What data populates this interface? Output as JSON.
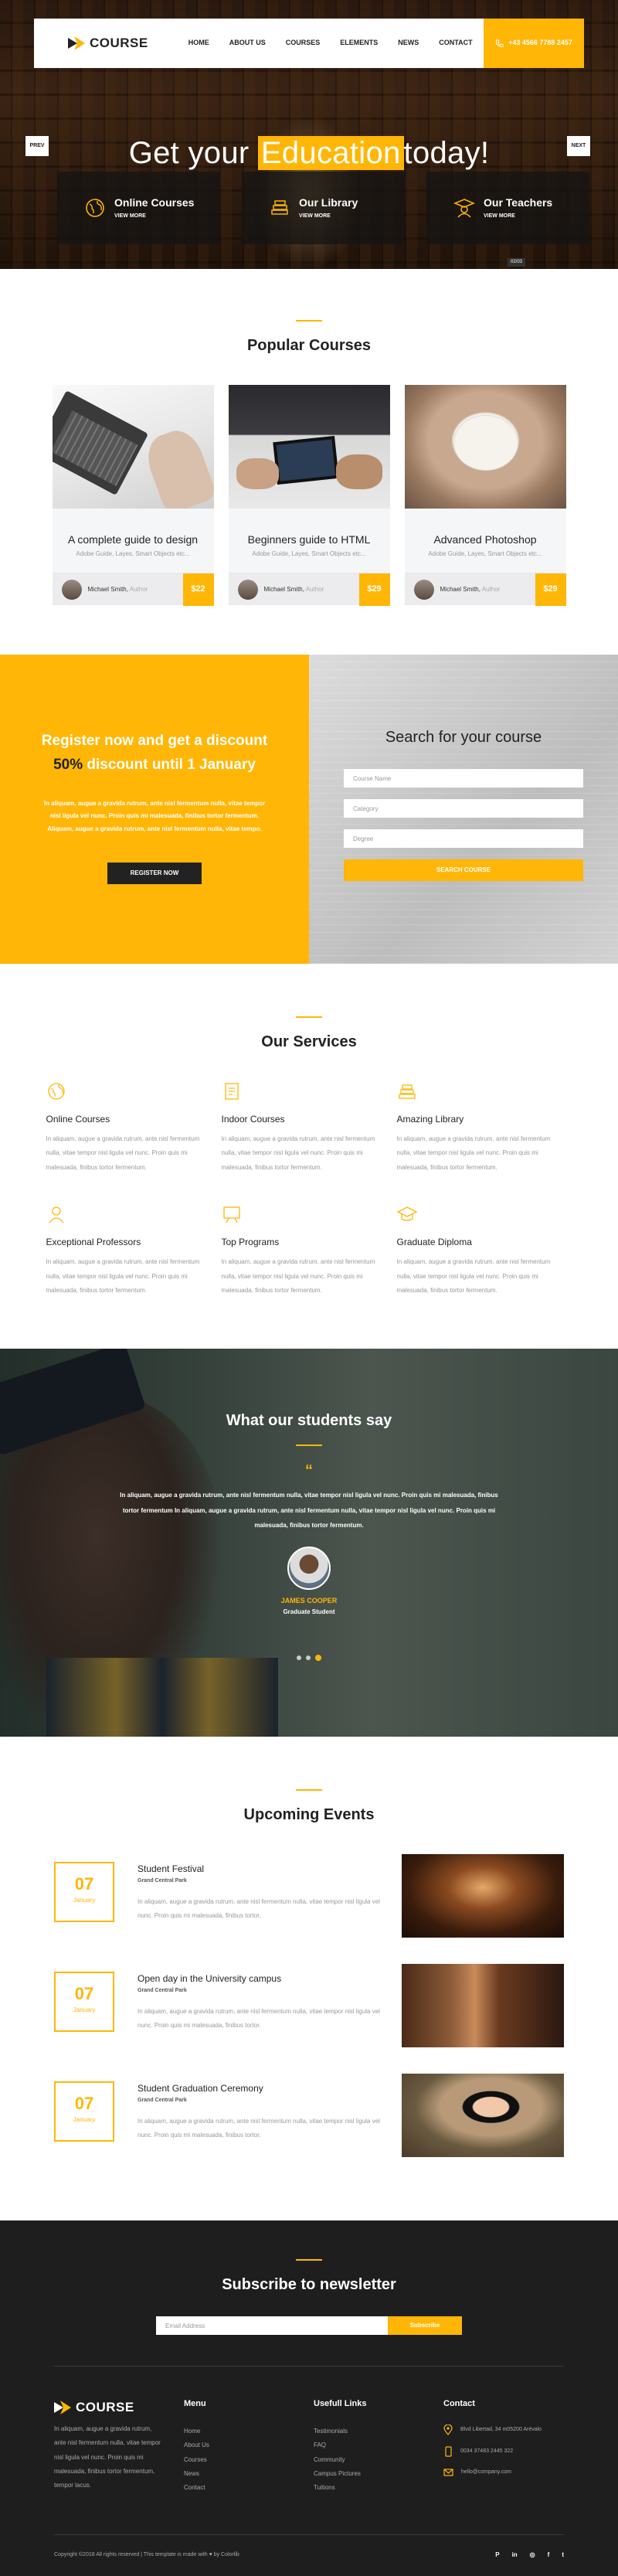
{
  "colors": {
    "accent": "#ffb606",
    "dark": "#1e1e1e",
    "text": "#222222",
    "muted": "#999999"
  },
  "brand": {
    "name": "COURSE"
  },
  "nav": {
    "items": [
      "HOME",
      "ABOUT US",
      "COURSES",
      "ELEMENTS",
      "NEWS",
      "CONTACT"
    ],
    "phone": "+43 4566 7788 2457"
  },
  "hero": {
    "title_before": "Get your",
    "title_highlight": "Education",
    "title_after": "today!",
    "prev": "PREV",
    "next": "NEXT",
    "slide_number": "02/03",
    "features": [
      {
        "title": "Online Courses",
        "link": "VIEW MORE",
        "icon": "earth-icon"
      },
      {
        "title": "Our Library",
        "link": "VIEW MORE",
        "icon": "books-icon"
      },
      {
        "title": "Our Teachers",
        "link": "VIEW MORE",
        "icon": "teacher-icon"
      }
    ]
  },
  "courses": {
    "title": "Popular Courses",
    "items": [
      {
        "title": "A complete guide to design",
        "subtitle": "Adobe Guide, Layes, Smart Objects etc...",
        "author": "Michael Smith,",
        "role": "Author",
        "price": "$22"
      },
      {
        "title": "Beginners guide to HTML",
        "subtitle": "Adobe Guide, Layes, Smart Objects etc...",
        "author": "Michael Smith,",
        "role": "Author",
        "price": "$29"
      },
      {
        "title": "Advanced Photoshop",
        "subtitle": "Adobe Guide, Layes, Smart Objects etc...",
        "author": "Michael Smith,",
        "role": "Author",
        "price": "$29"
      }
    ]
  },
  "register": {
    "line1": "Register now and get a discount",
    "percent": "50%",
    "line2": "discount until 1 January",
    "text": "In aliquam, augue a gravida rutrum, ante nisl fermentum nulla, vitae tempor nisl ligula vel nunc. Proin quis mi malesuada, finibus tortor fermentum. Aliquam, augue a gravida rutrum, ante nisl fermentum nulla, vitae tempo.",
    "button": "REGISTER NOW"
  },
  "search": {
    "title": "Search for your course",
    "placeholders": [
      "Course Name",
      "Category",
      "Degree"
    ],
    "button": "SEARCH COURSE"
  },
  "services": {
    "title": "Our Services",
    "text": "In aliquam, augue a gravida rutrum, ante nisl fermentum nulla, vitae tempor nisl ligula vel nunc. Proin quis mi malesuada, finibus tortor fermentum.",
    "items": [
      {
        "title": "Online Courses",
        "icon": "earth-icon"
      },
      {
        "title": "Indoor Courses",
        "icon": "book-icon"
      },
      {
        "title": "Amazing Library",
        "icon": "books-icon"
      },
      {
        "title": "Exceptional Professors",
        "icon": "professor-icon"
      },
      {
        "title": "Top Programs",
        "icon": "blackboard-icon"
      },
      {
        "title": "Graduate Diploma",
        "icon": "mortarboard-icon"
      }
    ]
  },
  "testimonial": {
    "title": "What our students say",
    "quote_mark": "“",
    "text": "In aliquam, augue a gravida rutrum, ante nisl fermentum nulla, vitae tempor nisl ligula vel nunc. Proin quis mi malesuada, finibus tortor fermentum In aliquam, augue a gravida rutrum, ante nisl fermentum nulla, vitae tempor nisl ligula vel nunc. Proin quis mi malesuada, finibus tortor fermentum.",
    "name": "JAMES COOPER",
    "role": "Graduate Student",
    "active_dot": 2,
    "dot_count": 3
  },
  "events": {
    "title": "Upcoming Events",
    "items": [
      {
        "day": "07",
        "month": "January",
        "title": "Student Festival",
        "location": "Grand Central Park",
        "text": "In aliquam, augue a gravida rutrum, ante nisl fermentum nulla, vitae tempor nisl ligula vel nunc. Proin quis mi malesuada, finibus tortor."
      },
      {
        "day": "07",
        "month": "January",
        "title": "Open day in the University campus",
        "location": "Grand Central Park",
        "text": "In aliquam, augue a gravida rutrum, ante nisl fermentum nulla, vitae tempor nisl ligula vel nunc. Proin quis mi malesuada, finibus tortor."
      },
      {
        "day": "07",
        "month": "January",
        "title": "Student Graduation Ceremony",
        "location": "Grand Central Park",
        "text": "In aliquam, augue a gravida rutrum, ante nisl fermentum nulla, vitae tempor nisl ligula vel nunc. Proin quis mi malesuada, finibus tortor."
      }
    ]
  },
  "newsletter": {
    "title": "Subscribe to newsletter",
    "placeholder": "Email Address",
    "button": "Subscribe"
  },
  "footer": {
    "about": "In aliquam, augue a gravida rutrum, ante nisl fermentum nulla, vitae tempor nisl ligula vel nunc. Proin quis mi malesuada, finibus tortor fermentum, tempor lacus.",
    "menu_title": "Menu",
    "menu": [
      "Home",
      "About Us",
      "Courses",
      "News",
      "Contact"
    ],
    "links_title": "Usefull Links",
    "links": [
      "Testimonials",
      "FAQ",
      "Community",
      "Campus Pictures",
      "Tuitions"
    ],
    "contact_title": "Contact",
    "address": "Blvd Libertad, 34 m05200 Arévalo",
    "phone": "0034 37483 2445 322",
    "email": "hello@company.com",
    "copyright": "Copyright ©2018 All rights reserved | This template is made with ♥ by Colorlib",
    "socials": [
      "P",
      "in",
      "◎",
      "f",
      "t"
    ]
  }
}
